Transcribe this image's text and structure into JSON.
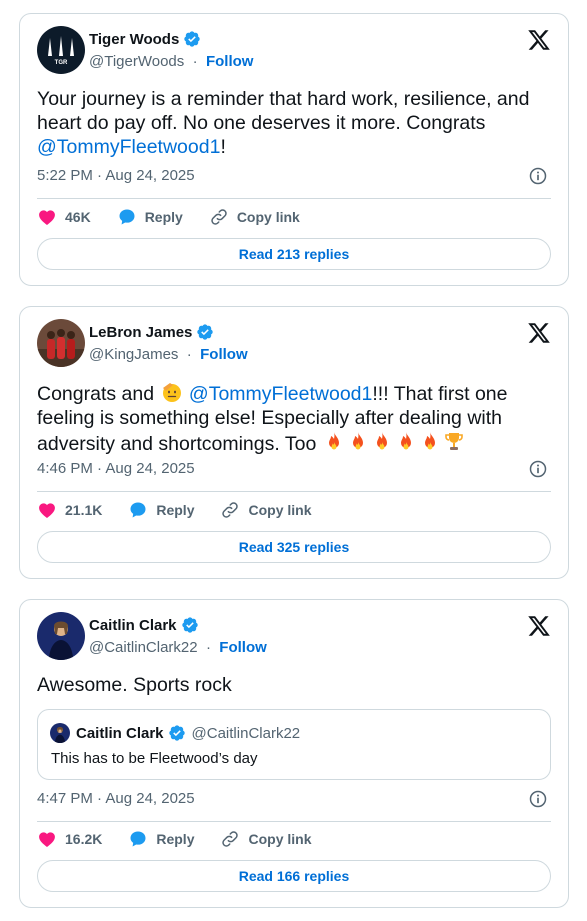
{
  "tweets": [
    {
      "name": "Tiger Woods",
      "handle": "@TigerWoods",
      "separator": "·",
      "follow_label": "Follow",
      "text_before": "Your journey is a reminder that hard work, resilience, and heart do pay off. No one deserves it more. Congrats ",
      "mention": "@TommyFleetwood1",
      "text_after": "!",
      "timestamp": "5:22 PM · Aug 24, 2025",
      "likes": "46K",
      "reply_label": "Reply",
      "copy_label": "Copy link",
      "read_replies_label": "Read 213 replies",
      "avatar_text": "TGR"
    },
    {
      "name": "LeBron James",
      "handle": "@KingJames",
      "separator": "·",
      "follow_label": "Follow",
      "text_part1": "Congrats and ",
      "mention": "@TommyFleetwood1",
      "text_part2": "!!! That first one feeling  is something else! Especially after dealing with adversity and shortcomings. Too ",
      "timestamp": "4:46 PM · Aug 24, 2025",
      "likes": "21.1K",
      "reply_label": "Reply",
      "copy_label": "Copy link",
      "read_replies_label": "Read 325 replies"
    },
    {
      "name": "Caitlin Clark",
      "handle": "@CaitlinClark22",
      "separator": "·",
      "follow_label": "Follow",
      "text": "Awesome. Sports rock",
      "quote": {
        "name": "Caitlin Clark",
        "handle": "@CaitlinClark22",
        "text": "This has to be Fleetwood’s day"
      },
      "timestamp": "4:47 PM · Aug 24, 2025",
      "likes": "16.2K",
      "reply_label": "Reply",
      "copy_label": "Copy link",
      "read_replies_label": "Read 166 replies"
    }
  ],
  "colors": {
    "link": "#006fd6",
    "verified": "#1d9bf0",
    "heart": "#f91880",
    "muted": "#536471",
    "border": "#cfd9de"
  },
  "icons": [
    "x-logo-icon",
    "verified-badge-icon",
    "info-icon",
    "heart-icon",
    "reply-bubble-icon",
    "copy-link-icon",
    "fire-emoji",
    "trophy-emoji",
    "salute-emoji"
  ]
}
